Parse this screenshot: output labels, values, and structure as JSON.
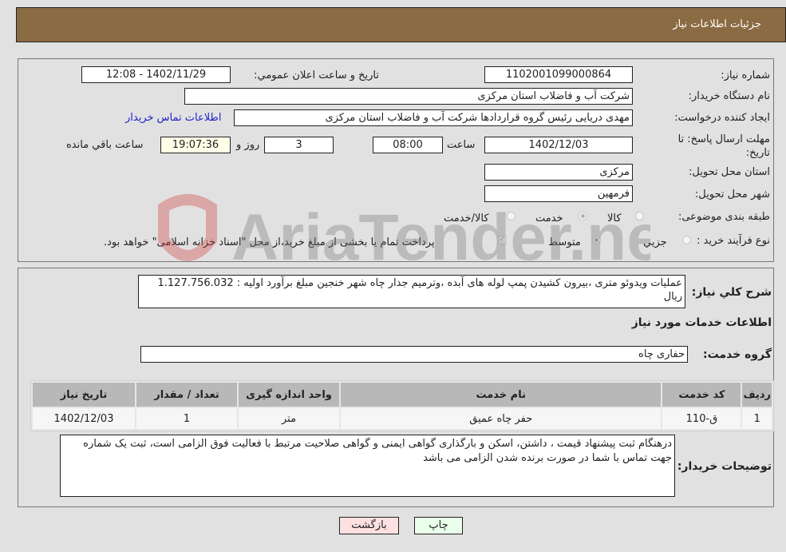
{
  "header": {
    "title": "جزئیات اطلاعات نیاز"
  },
  "form": {
    "need_number_label": "شماره نیاز:",
    "need_number": "1102001099000864",
    "announce_label": "تاریخ و ساعت اعلان عمومي:",
    "announce_value": "1402/11/29 - 12:08",
    "buyer_org_label": "نام دستگاه خریدار:",
    "buyer_org": "شرکت آب و فاضلاب استان مرکزی",
    "creator_label": "ایجاد کننده درخواست:",
    "creator": "مهدی دریایی رئیس گروه قراردادها شرکت آب و فاضلاب استان مرکزی",
    "contact_link": "اطلاعات تماس خریدار",
    "deadline_label": "مهلت ارسال پاسخ: تا تاریخ:",
    "deadline_date": "1402/12/03",
    "time_label": "ساعت",
    "deadline_time": "08:00",
    "days_value": "3",
    "days_label": "روز و",
    "remaining_time": "19:07:36",
    "remaining_label": "ساعت باقي مانده",
    "province_label": "استان محل تحویل:",
    "province": "مرکزی",
    "city_label": "شهر محل تحویل:",
    "city": "فرمهین",
    "category_label": "طبقه بندی موضوعی:",
    "category_options": [
      {
        "label": "کالا",
        "checked": false
      },
      {
        "label": "خدمت",
        "checked": true
      },
      {
        "label": "کالا/خدمت",
        "checked": false
      }
    ],
    "process_label": "نوع فرآیند خرید :",
    "process_options": [
      {
        "label": "جزيي",
        "checked": false
      },
      {
        "label": "متوسط",
        "checked": true
      }
    ],
    "treasury_note": "پرداخت تمام یا بخشی از مبلغ خرید،از محل \"اسناد خزانه اسلامی\" خواهد بود."
  },
  "description": {
    "label": "شرح کلي نیاز:",
    "text": "عملیات ویدوئو متری ،بیرون کشیدن پمپ لوله های آبده ،وترمیم جدار چاه شهر خنجین  مبلغ برآورد اولیه : 1.127.756.032 ریال"
  },
  "services": {
    "section_title": "اطلاعات خدمات مورد نیاز",
    "group_label": "گروه خدمت:",
    "group_value": "حفاری چاه",
    "columns": [
      "ردیف",
      "کد خدمت",
      "نام خدمت",
      "واحد اندازه گیری",
      "تعداد / مقدار",
      "تاریخ نیاز"
    ],
    "rows": [
      [
        "1",
        "ق-110",
        "حفر چاه عمیق",
        "متر",
        "1",
        "1402/12/03"
      ]
    ]
  },
  "buyer_notes": {
    "label": "توضیحات خریدار:",
    "text": "درهنگام ثبت پیشنهاد قیمت ، داشتن، اسکن و بارگذاری گواهی ایمنی و گواهی صلاحیت مرتبط با فعالیت فوق الزامی است، ثبت یک شماره جهت تماس با شما در صورت برنده شدن الزامی می باشد"
  },
  "buttons": {
    "print": "چاپ",
    "back": "بازگشت"
  },
  "watermark": {
    "text": "AriaTender.neT"
  }
}
